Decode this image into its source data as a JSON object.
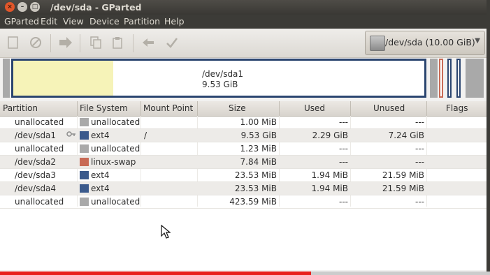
{
  "window": {
    "title": "/dev/sda - GParted",
    "close_glyph": "×",
    "min_glyph": "–",
    "max_glyph": "□"
  },
  "menu": [
    "GParted",
    "Edit",
    "View",
    "Device",
    "Partition",
    "Help"
  ],
  "toolbar": {
    "icons": [
      "new-partition-icon",
      "delete-icon",
      "resize-move-icon",
      "copy-icon",
      "paste-icon",
      "undo-icon",
      "apply-icon"
    ],
    "device_selector": {
      "label": "/dev/sda  (10.00 GiB)",
      "arrow": "▼"
    }
  },
  "disk_map": {
    "selected_partition": "/dev/sda1",
    "selected_size": "9.53 GiB"
  },
  "table": {
    "columns": [
      "Partition",
      "File System",
      "Mount Point",
      "Size",
      "Used",
      "Unused",
      "Flags"
    ],
    "rows": [
      {
        "partition": "unallocated",
        "fs": "unallocated",
        "mount": "",
        "size": "1.00 MiB",
        "used": "---",
        "unused": "---",
        "flags": "",
        "color": "#a9a9a9"
      },
      {
        "partition": "/dev/sda1",
        "fs": "ext4",
        "mount": "/",
        "size": "9.53 GiB",
        "used": "2.29 GiB",
        "unused": "7.24 GiB",
        "flags": "",
        "color": "#3b5a8c",
        "mounted": true
      },
      {
        "partition": "unallocated",
        "fs": "unallocated",
        "mount": "",
        "size": "1.23 MiB",
        "used": "---",
        "unused": "---",
        "flags": "",
        "color": "#a9a9a9"
      },
      {
        "partition": "/dev/sda2",
        "fs": "linux-swap",
        "mount": "",
        "size": "7.84 MiB",
        "used": "---",
        "unused": "---",
        "flags": "",
        "color": "#c86a55"
      },
      {
        "partition": "/dev/sda3",
        "fs": "ext4",
        "mount": "",
        "size": "23.53 MiB",
        "used": "1.94 MiB",
        "unused": "21.59 MiB",
        "flags": "",
        "color": "#3b5a8c"
      },
      {
        "partition": "/dev/sda4",
        "fs": "ext4",
        "mount": "",
        "size": "23.53 MiB",
        "used": "1.94 MiB",
        "unused": "21.59 MiB",
        "flags": "",
        "color": "#3b5a8c"
      },
      {
        "partition": "unallocated",
        "fs": "unallocated",
        "mount": "",
        "size": "423.59 MiB",
        "used": "---",
        "unused": "---",
        "flags": "",
        "color": "#a9a9a9"
      }
    ]
  },
  "video_progress": 0.635
}
